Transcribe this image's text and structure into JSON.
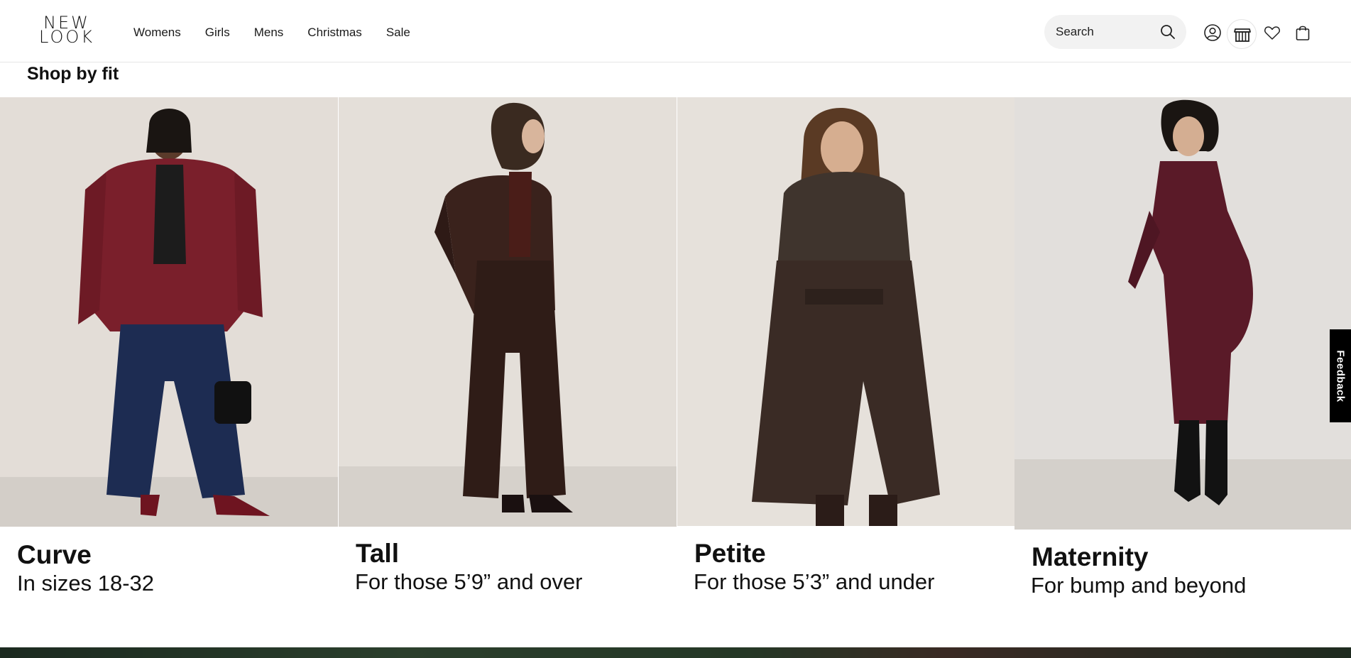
{
  "brand": {
    "line1": "NEW",
    "line2": "LOOK"
  },
  "nav": [
    "Womens",
    "Girls",
    "Mens",
    "Christmas",
    "Sale"
  ],
  "search": {
    "placeholder": "Search",
    "icon": "search-icon"
  },
  "header_icons": [
    "account-icon",
    "store-icon",
    "wishlist-heart-icon",
    "shopping-bag-icon"
  ],
  "section": {
    "title": "Shop by fit"
  },
  "tiles": [
    {
      "label": "Curve",
      "desc": "In sizes 18-32"
    },
    {
      "label": "Tall",
      "desc": "For those 5’9” and over"
    },
    {
      "label": "Petite",
      "desc": "For those 5’3” and under"
    },
    {
      "label": "Maternity",
      "desc": "For bump and beyond"
    }
  ],
  "feedback": {
    "label": "Feedback"
  },
  "colors": {
    "accent": "#111111",
    "search_bg": "#f2f2f2",
    "photo_bg": "#e3ddd7"
  }
}
